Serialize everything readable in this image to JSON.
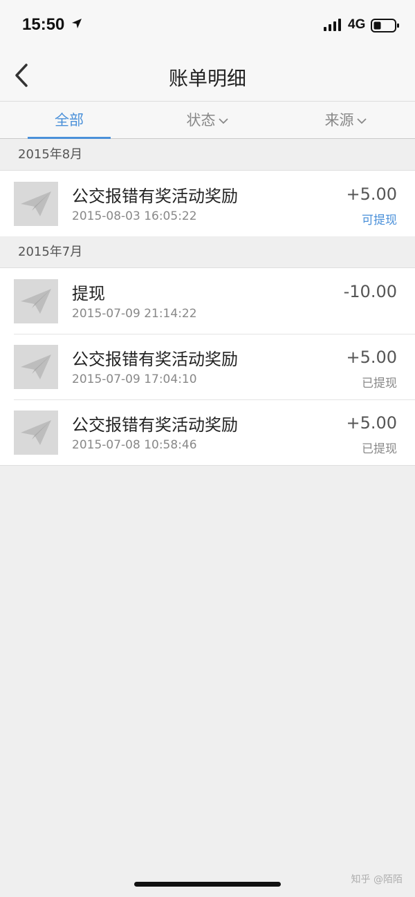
{
  "status_bar": {
    "time": "15:50",
    "network": "4G",
    "icons": [
      "location-arrow-icon",
      "signal-icon",
      "battery-icon"
    ]
  },
  "nav": {
    "title": "账单明细",
    "back_icon": "chevron-left-icon"
  },
  "tabs": [
    {
      "label": "全部",
      "active": true
    },
    {
      "label": "状态",
      "active": false,
      "icon": "chevron-down-icon"
    },
    {
      "label": "来源",
      "active": false,
      "icon": "chevron-down-icon"
    }
  ],
  "sections": [
    {
      "header": "2015年8月",
      "items": [
        {
          "icon": "paper-plane-icon",
          "title": "公交报错有奖活动奖励",
          "time": "2015-08-03 16:05:22",
          "amount": "+5.00",
          "status": "可提现"
        }
      ]
    },
    {
      "header": "2015年7月",
      "items": [
        {
          "icon": "paper-plane-icon",
          "title": "提现",
          "time": "2015-07-09 21:14:22",
          "amount": "-10.00",
          "status": ""
        },
        {
          "icon": "paper-plane-icon",
          "title": "公交报错有奖活动奖励",
          "time": "2015-07-09 17:04:10",
          "amount": "+5.00",
          "status": "已提现"
        },
        {
          "icon": "paper-plane-icon",
          "title": "公交报错有奖活动奖励",
          "time": "2015-07-08 10:58:46",
          "amount": "+5.00",
          "status": "已提现"
        }
      ]
    }
  ],
  "watermark": "知乎 @陌陌",
  "colors": {
    "accent": "#4a90d9",
    "background": "#efefef",
    "row_background": "#ffffff",
    "thumb_background": "#d9d9d9"
  }
}
